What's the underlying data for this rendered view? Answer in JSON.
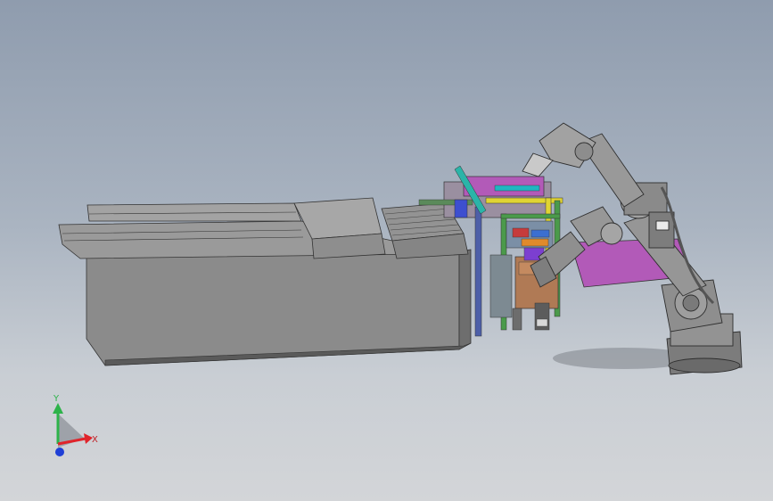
{
  "viewport": {
    "background_top": "#8f9cae",
    "background_bottom": "#d3d5d8"
  },
  "triad": {
    "x_label": "X",
    "y_label": "Y",
    "x_color": "#e0242b",
    "y_color": "#2db34a",
    "z_color": "#1f3fd6"
  },
  "model": {
    "robot_color": "#8c8c8c",
    "base_plate_color": "#b25ab8",
    "conveyor_color": "#8a8a8a",
    "cabinet_color": "#b07a55"
  }
}
